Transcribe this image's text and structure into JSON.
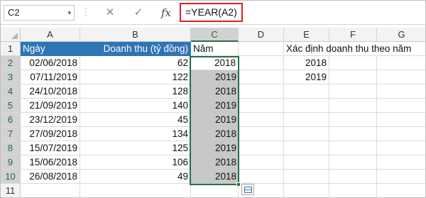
{
  "name_box": "C2",
  "formula": "=YEAR(A2)",
  "toolbar": {
    "cancel": "✕",
    "enter": "✓",
    "fx": "fx",
    "dropdown": "▾"
  },
  "columns": [
    "A",
    "B",
    "C",
    "D",
    "E",
    "F",
    "G"
  ],
  "rows": [
    "1",
    "2",
    "3",
    "4",
    "5",
    "6",
    "7",
    "8",
    "9",
    "10",
    "11"
  ],
  "header": {
    "a": "Ngày",
    "b": "Doanh thu (tỷ đồng)",
    "c": "Năm",
    "e": "Xác định doanh thu theo năm"
  },
  "data": [
    {
      "date": "02/06/2018",
      "rev": "62",
      "year": "2018"
    },
    {
      "date": "07/11/2019",
      "rev": "122",
      "year": "2019"
    },
    {
      "date": "24/10/2018",
      "rev": "128",
      "year": "2018"
    },
    {
      "date": "21/09/2019",
      "rev": "140",
      "year": "2019"
    },
    {
      "date": "23/12/2019",
      "rev": "45",
      "year": "2019"
    },
    {
      "date": "27/09/2018",
      "rev": "134",
      "year": "2018"
    },
    {
      "date": "15/07/2019",
      "rev": "125",
      "year": "2019"
    },
    {
      "date": "15/06/2018",
      "rev": "106",
      "year": "2018"
    },
    {
      "date": "26/08/2018",
      "rev": "49",
      "year": "2018"
    }
  ],
  "summary_years": [
    "2018",
    "2019"
  ],
  "colors": {
    "header_fill": "#2e75b6",
    "selection": "#217346",
    "formula_highlight": "#e02020"
  }
}
